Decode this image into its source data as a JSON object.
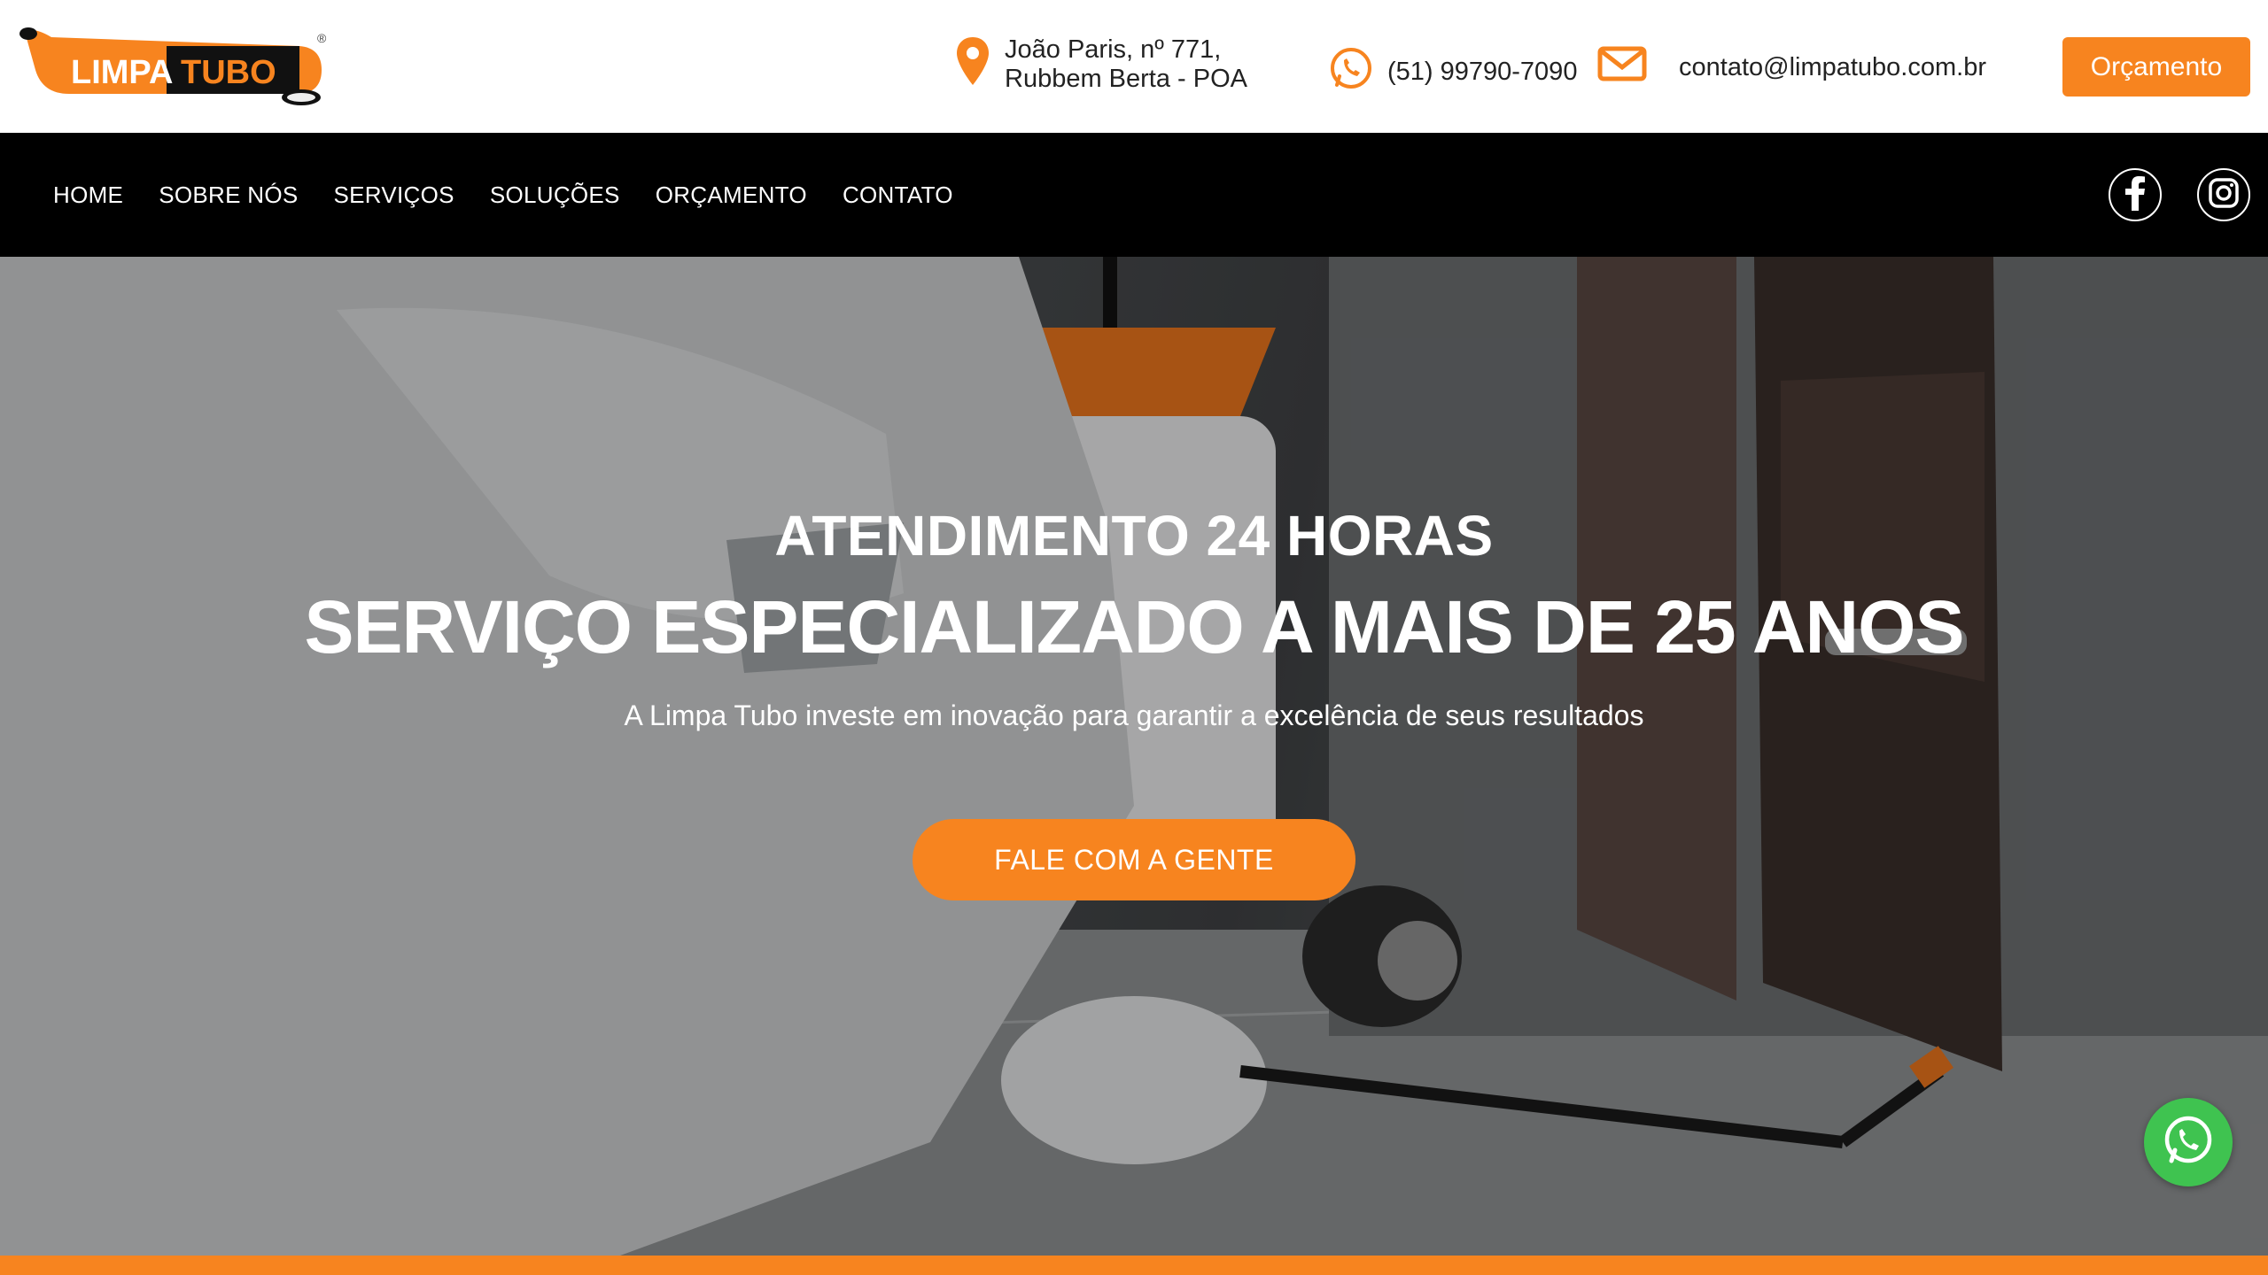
{
  "header": {
    "logo_left": "LIMPA",
    "logo_right": "TUBO",
    "logo_mark": "®",
    "address_line1": "João Paris, nº 771,",
    "address_line2": "Rubbem Berta - POA",
    "phone": "(51) 99790-7090",
    "email": "contato@limpatubo.com.br",
    "budget_button": "Orçamento"
  },
  "nav": {
    "items": [
      "HOME",
      "SOBRE NÓS",
      "SERVIÇOS",
      "SOLUÇÕES",
      "ORÇAMENTO",
      "CONTATO"
    ]
  },
  "hero": {
    "subtitle": "ATENDIMENTO 24 HORAS",
    "title": "SERVIÇO ESPECIALIZADO A MAIS DE 25 ANOS",
    "description": "A Limpa Tubo investe em inovação para garantir a excelência de seus resultados",
    "cta": "FALE COM A GENTE"
  },
  "colors": {
    "accent": "#f7841f",
    "nav_bg": "#000000",
    "whatsapp": "#3fc350"
  },
  "icons": [
    "location-pin-icon",
    "whatsapp-icon",
    "envelope-icon",
    "facebook-icon",
    "instagram-icon"
  ]
}
